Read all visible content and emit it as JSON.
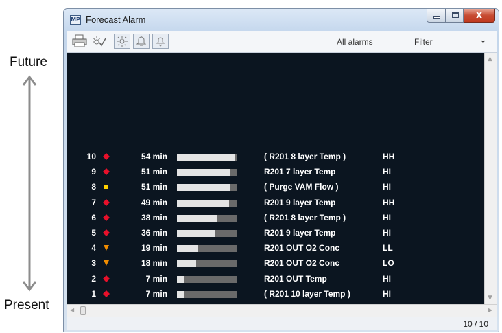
{
  "annotations": {
    "future": "Future",
    "present": "Present"
  },
  "window": {
    "title": "Forecast Alarm",
    "app_icon": "MP",
    "close_glyph": "x",
    "toolbar": {
      "icons": [
        "printer-icon",
        "alarm-check-icon",
        "alarm-light-icon",
        "bell-icon",
        "bell-down-icon"
      ],
      "all_alarms": "All alarms",
      "filter": "Filter"
    },
    "status": {
      "count": "10 / 10"
    }
  },
  "colors": {
    "diamond": "#e8102a",
    "square": "#ffd000",
    "triangle": "#f08c00",
    "panel": "#0b1520"
  },
  "alarms": [
    {
      "num": "10",
      "marker": "diamond",
      "minutes": "54 min",
      "progress": 0.95,
      "name": "( R201 8 layer Temp )",
      "level": "HH"
    },
    {
      "num": "9",
      "marker": "diamond",
      "minutes": "51 min",
      "progress": 0.89,
      "name": "R201 7 layer Temp",
      "level": "HI"
    },
    {
      "num": "8",
      "marker": "square",
      "minutes": "51 min",
      "progress": 0.89,
      "name": "( Purge VAM Flow )",
      "level": "HI"
    },
    {
      "num": "7",
      "marker": "diamond",
      "minutes": "49 min",
      "progress": 0.86,
      "name": "R201 9 layer Temp",
      "level": "HH"
    },
    {
      "num": "6",
      "marker": "diamond",
      "minutes": "38 min",
      "progress": 0.67,
      "name": "( R201 8 layer Temp )",
      "level": "HI"
    },
    {
      "num": "5",
      "marker": "diamond",
      "minutes": "36 min",
      "progress": 0.63,
      "name": "R201 9 layer Temp",
      "level": "HI"
    },
    {
      "num": "4",
      "marker": "triangle",
      "minutes": "19 min",
      "progress": 0.34,
      "name": "R201 OUT O2 Conc",
      "level": "LL"
    },
    {
      "num": "3",
      "marker": "triangle",
      "minutes": "18 min",
      "progress": 0.32,
      "name": "R201 OUT O2 Conc",
      "level": "LO"
    },
    {
      "num": "2",
      "marker": "diamond",
      "minutes": "7 min",
      "progress": 0.12,
      "name": "R201 OUT Temp",
      "level": "HI"
    },
    {
      "num": "1",
      "marker": "diamond",
      "minutes": "7 min",
      "progress": 0.12,
      "name": "( R201 10 layer Temp )",
      "level": "HI"
    }
  ]
}
